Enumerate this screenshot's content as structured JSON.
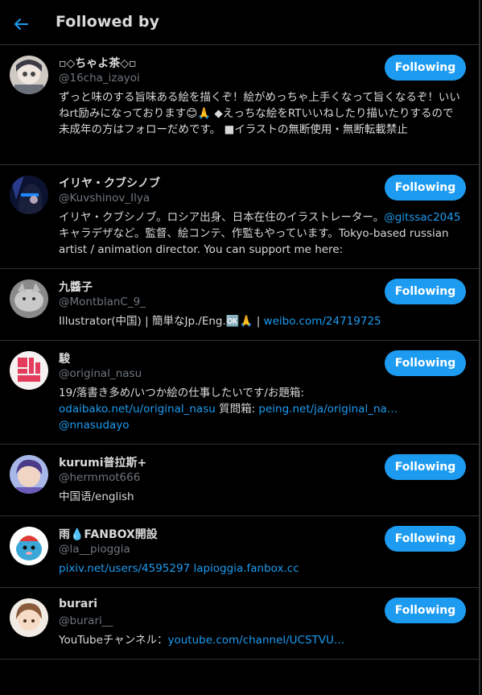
{
  "header": {
    "title": "Followed by",
    "back_icon": "arrow-left-icon",
    "accent": "#1d9bf0"
  },
  "users": [
    {
      "name": "▫◇ちゃよ茶◇▫",
      "handle": "@16cha_izayoi",
      "button": "Following",
      "bio_parts": [
        {
          "text": "ずっと味のする旨味ある絵を描くぞ！絵がめっちゃ上手くなって旨くなるぞ！いいねrt励みになっております😊🙏 ◆えっちな絵をRTいいねしたり描いたりするので未成年の方はフォローだめです。 ■イラストの無断使用・無断転載禁止"
        }
      ]
    },
    {
      "name": "イリヤ・クブシノブ",
      "handle": "@Kuvshinov_Ilya",
      "button": "Following",
      "bio_parts": [
        {
          "text": "イリヤ・クブシノブ。ロシア出身、日本在住のイラストレーター。"
        },
        {
          "text": "@gitssac2045",
          "link": true
        },
        {
          "text": "キャラデザなど。監督、絵コンテ、作監もやっています。Tokyo-based russian artist / animation director. You can support me here:"
        }
      ]
    },
    {
      "name": "九醬子",
      "handle": "@MontblanC_9_",
      "button": "Following",
      "bio_parts": [
        {
          "text": "Illustrator(中国) | 簡単なJp./Eng.🆗🙏 | "
        },
        {
          "text": "weibo.com/24719725",
          "link": true
        }
      ]
    },
    {
      "name": "駿",
      "handle": "@original_nasu",
      "button": "Following",
      "bio_parts": [
        {
          "text": "19/落書き多め/いつか絵の仕事したいです/お題箱: "
        },
        {
          "text": "odaibako.net/u/original_nasu",
          "link": true
        },
        {
          "text": " 質問箱: "
        },
        {
          "text": "peing.net/ja/original_na…",
          "link": true
        },
        {
          "text": " "
        },
        {
          "text": "@nnasudayo",
          "link": true
        }
      ]
    },
    {
      "name": "kurumi普拉斯+",
      "handle": "@hermmot666",
      "button": "Following",
      "bio_parts": [
        {
          "text": "中国语/english"
        }
      ]
    },
    {
      "name": "雨💧FANBOX開設",
      "handle": "@la__pioggia",
      "button": "Following",
      "bio_parts": [
        {
          "text": "pixiv.net/users/4595297",
          "link": true
        },
        {
          "text": " "
        },
        {
          "text": "lapioggia.fanbox.cc",
          "link": true
        }
      ]
    },
    {
      "name": "burari",
      "handle": "@burari__",
      "button": "Following",
      "bio_parts": [
        {
          "text": "YouTubeチャンネル："
        },
        {
          "text": "youtube.com/channel/UCSTVU…",
          "link": true
        }
      ]
    }
  ]
}
